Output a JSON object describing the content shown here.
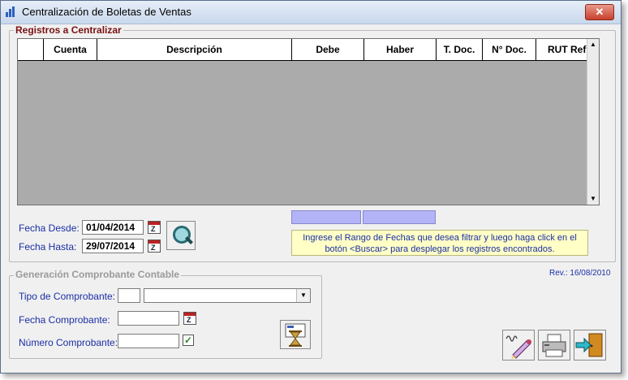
{
  "window": {
    "title": "Centralización de Boletas de Ventas",
    "close_label": "✕"
  },
  "registros": {
    "legend": "Registros a Centralizar",
    "columns": [
      "",
      "Cuenta",
      "Descripción",
      "Debe",
      "Haber",
      "T. Doc.",
      "N° Doc.",
      "RUT Ref"
    ],
    "rows": []
  },
  "fechas": {
    "desde_label": "Fecha Desde:",
    "desde_value": "01/04/2014",
    "hasta_label": "Fecha Hasta:",
    "hasta_value": "29/07/2014"
  },
  "info_text": "Ingrese el Rango de Fechas que desea filtrar y luego haga click en el botón <Buscar> para desplegar los registros encontrados.",
  "revision": "Rev.: 16/08/2010",
  "comprobante": {
    "legend": "Generación Comprobante Contable",
    "tipo_label": "Tipo de Comprobante:",
    "tipo_code": "",
    "tipo_selected": "",
    "fecha_label": "Fecha Comprobante:",
    "fecha_value": "",
    "numero_label": "Número Comprobante:",
    "numero_value": "",
    "numero_auto_checked": true
  },
  "icons": {
    "calendar": "calendar-icon",
    "search": "search-icon",
    "generate": "hourglass-icon",
    "sign": "sign-icon",
    "print": "printer-icon",
    "exit": "exit-door-icon"
  },
  "colors": {
    "legend_red": "#7a1010",
    "label_blue": "#1a2fa5",
    "grid_bg": "#ababab",
    "totals_bg": "#b3b3f7",
    "info_bg": "#ffffc6"
  }
}
